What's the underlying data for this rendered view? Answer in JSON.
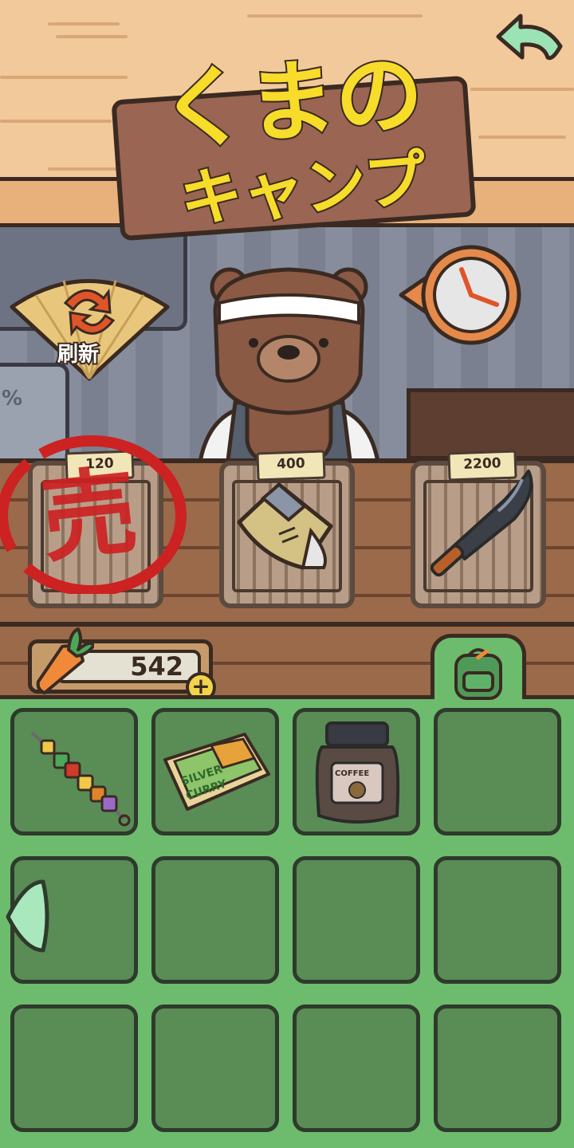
{
  "title": {
    "line1": "くまの",
    "line2": "キャンプ"
  },
  "refresh": {
    "label": "刷新"
  },
  "shop": {
    "items": [
      {
        "price": "120",
        "item": "sold-item",
        "sold_mark": "売"
      },
      {
        "price": "400",
        "item": "sleeping-bag"
      },
      {
        "price": "2200",
        "item": "machete"
      }
    ]
  },
  "wallet": {
    "carrots": "542",
    "add_symbol": "+"
  },
  "bag": {
    "slots": [
      {
        "item": "vegetable-skewer"
      },
      {
        "item": "silver-curry-box",
        "label1": "SILVER",
        "label2": "CURRY"
      },
      {
        "item": "coffee-jar",
        "label": "COFFEE"
      },
      {
        "item": ""
      },
      {
        "item": ""
      },
      {
        "item": ""
      },
      {
        "item": ""
      },
      {
        "item": ""
      },
      {
        "item": ""
      },
      {
        "item": ""
      },
      {
        "item": ""
      },
      {
        "item": ""
      }
    ]
  },
  "colors": {
    "bag_green": "#6dbb6d",
    "slot_green": "#5a8c56",
    "title_yellow": "#f7dc2a",
    "stamp_red": "#cc2222"
  }
}
